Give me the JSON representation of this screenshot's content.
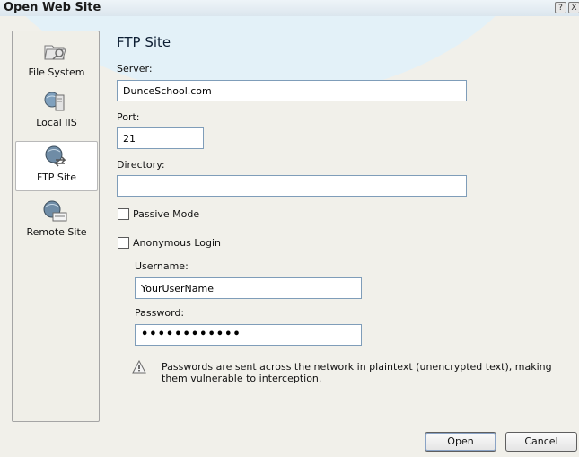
{
  "window": {
    "title": "Open Web Site",
    "help_glyph": "?",
    "close_glyph": "X"
  },
  "sidebar": {
    "items": [
      {
        "label": "File System",
        "icon": "folder-icon",
        "selected": false
      },
      {
        "label": "Local IIS",
        "icon": "local-iis-icon",
        "selected": false
      },
      {
        "label": "FTP Site",
        "icon": "ftp-globe-icon",
        "selected": true
      },
      {
        "label": "Remote Site",
        "icon": "http-globe-icon",
        "selected": false
      }
    ]
  },
  "main": {
    "heading": "FTP Site",
    "server": {
      "label": "Server:",
      "value": "DunceSchool.com"
    },
    "port": {
      "label": "Port:",
      "value": "21"
    },
    "directory": {
      "label": "Directory:",
      "value": ""
    },
    "passive_mode": {
      "label": "Passive Mode",
      "checked": false
    },
    "anonymous_login": {
      "label": "Anonymous Login",
      "checked": false
    },
    "username": {
      "label": "Username:",
      "value": "YourUserName"
    },
    "password": {
      "label": "Password:",
      "value": "••••••••••••"
    },
    "warning": "Passwords are sent across the network in plaintext (unencrypted text), making them vulnerable to interception."
  },
  "buttons": {
    "open": "Open",
    "cancel": "Cancel"
  }
}
